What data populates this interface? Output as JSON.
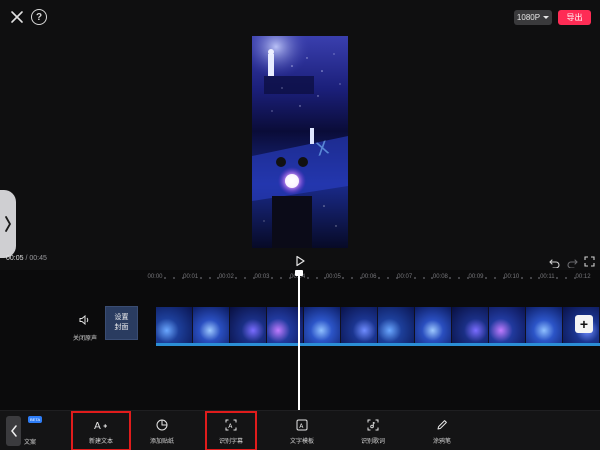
{
  "header": {
    "resolution_label": "1080P",
    "export_label": "导出"
  },
  "preview": {
    "current_time": "00:05",
    "separator": " / ",
    "total_time": "00:45"
  },
  "ruler": {
    "ticks": [
      "00:00",
      "00:01",
      "00:02",
      "00:03",
      "00:04",
      "00:05",
      "00:06",
      "00:07",
      "00:08",
      "00:09",
      "00:10",
      "00:11",
      "00:12"
    ]
  },
  "timeline": {
    "mute_label": "关闭原声",
    "cover_line1": "设置",
    "cover_line2": "封面"
  },
  "toolbar": {
    "beta_badge": "BETA",
    "partial_label": "文案",
    "items": [
      {
        "label": "新建文本",
        "icon": "text-add-icon",
        "highlighted": true
      },
      {
        "label": "添加贴纸",
        "icon": "sticker-icon",
        "highlighted": false
      },
      {
        "label": "识别字幕",
        "icon": "caption-recognize-icon",
        "highlighted": true
      },
      {
        "label": "文字模板",
        "icon": "text-template-icon",
        "highlighted": false
      },
      {
        "label": "识别歌词",
        "icon": "lyrics-recognize-icon",
        "highlighted": false
      },
      {
        "label": "涂鸦笔",
        "icon": "pen-icon",
        "highlighted": false
      }
    ]
  },
  "colors": {
    "export": "#fe2c55",
    "highlight": "#e01c1c",
    "clip_line": "#2b8fd6"
  }
}
